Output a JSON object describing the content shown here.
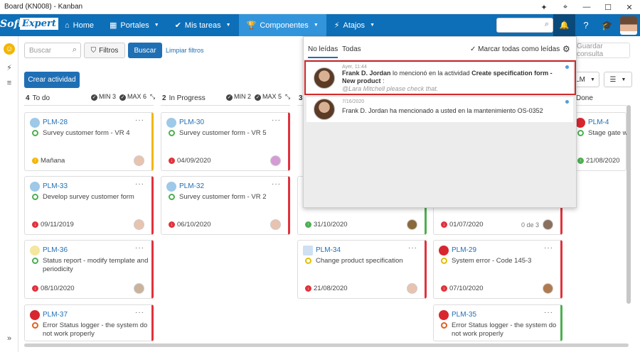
{
  "window": {
    "title": "Board (KN008) - Kanban"
  },
  "navbar": {
    "logo_soft": "Soft",
    "logo_expert": "Expert",
    "items": [
      {
        "label": "Home",
        "icon": "home-icon"
      },
      {
        "label": "Portales",
        "icon": "grid-icon"
      },
      {
        "label": "Mis tareas",
        "icon": "check-icon"
      },
      {
        "label": "Componentes",
        "icon": "trophy-icon"
      },
      {
        "label": "Atajos",
        "icon": "bolt-icon"
      }
    ]
  },
  "toolbar": {
    "search_placeholder": "Buscar",
    "filters_label": "Filtros",
    "search_button": "Buscar",
    "clear_filters": "Limpiar filtros",
    "save_query": "Guardar consulta",
    "create_activity": "Crear actividad",
    "view_label": "LM"
  },
  "columns": [
    {
      "count": "4",
      "name": "To do",
      "min": "MIN 3",
      "max": "MAX 6"
    },
    {
      "count": "2",
      "name": "In Progress",
      "min": "MIN 2",
      "max": "MAX 5"
    },
    {
      "count": "3",
      "name": "",
      "min": "",
      "max": ""
    },
    {
      "count": "",
      "name": "",
      "min": "",
      "max": ""
    },
    {
      "count": "",
      "name": "Done",
      "min": "",
      "max": ""
    }
  ],
  "cards": {
    "c1": {
      "code": "PLM-28",
      "desc": "Survey customer form - VR 4",
      "due": "Mañana"
    },
    "c2": {
      "code": "PLM-33",
      "desc": "Develop survey customer form",
      "due": "09/11/2019"
    },
    "c3": {
      "code": "PLM-36",
      "desc": "Status report - modify template and periodicity",
      "due": "08/10/2020"
    },
    "c4": {
      "code": "PLM-37",
      "desc": "Error Status logger - the system do not work properly",
      "due": ""
    },
    "c5": {
      "code": "PLM-30",
      "desc": "Survey customer form - VR 5",
      "due": "04/09/2020"
    },
    "c6": {
      "code": "PLM-32",
      "desc": "Survey customer form - VR 2",
      "due": "06/10/2020"
    },
    "c7": {
      "code": "",
      "desc": "",
      "due": "31/10/2020"
    },
    "c8": {
      "code": "PLM-34",
      "desc": "Change product specification",
      "due": "21/08/2020"
    },
    "c9": {
      "code": "",
      "desc": "",
      "due": "01/07/2020",
      "sub": "0 de 3"
    },
    "c10": {
      "code": "PLM-29",
      "desc": "System error - Code 145-3",
      "due": "07/10/2020"
    },
    "c11": {
      "code": "PLM-35",
      "desc": "Error Status logger - the system do not work properly",
      "due": ""
    },
    "c12": {
      "code": "PLM-4",
      "desc": "Stage gate wor",
      "due": "21/08/2020"
    }
  },
  "notifications": {
    "tab_unread": "No leídas",
    "tab_all": "Todas",
    "mark_all": "Marcar todas como leídas",
    "items": [
      {
        "time": "Ayer, 11:44",
        "author": "Frank D. Jordan",
        "text": " lo mencionó en la actividad ",
        "activity": "Create specification form - New product",
        "tail": " :",
        "quote": "@Lara Mitchell please check that."
      },
      {
        "time": "7/16/2020",
        "author": "Frank D. Jordan",
        "text": " ha mencionado a usted en la mantenimiento OS-0352"
      }
    ]
  },
  "colors": {
    "brand": "#0d6fb8",
    "active": "#3295dc",
    "red": "#e0323c",
    "yellow": "#f2b705",
    "green": "#4caf50"
  }
}
